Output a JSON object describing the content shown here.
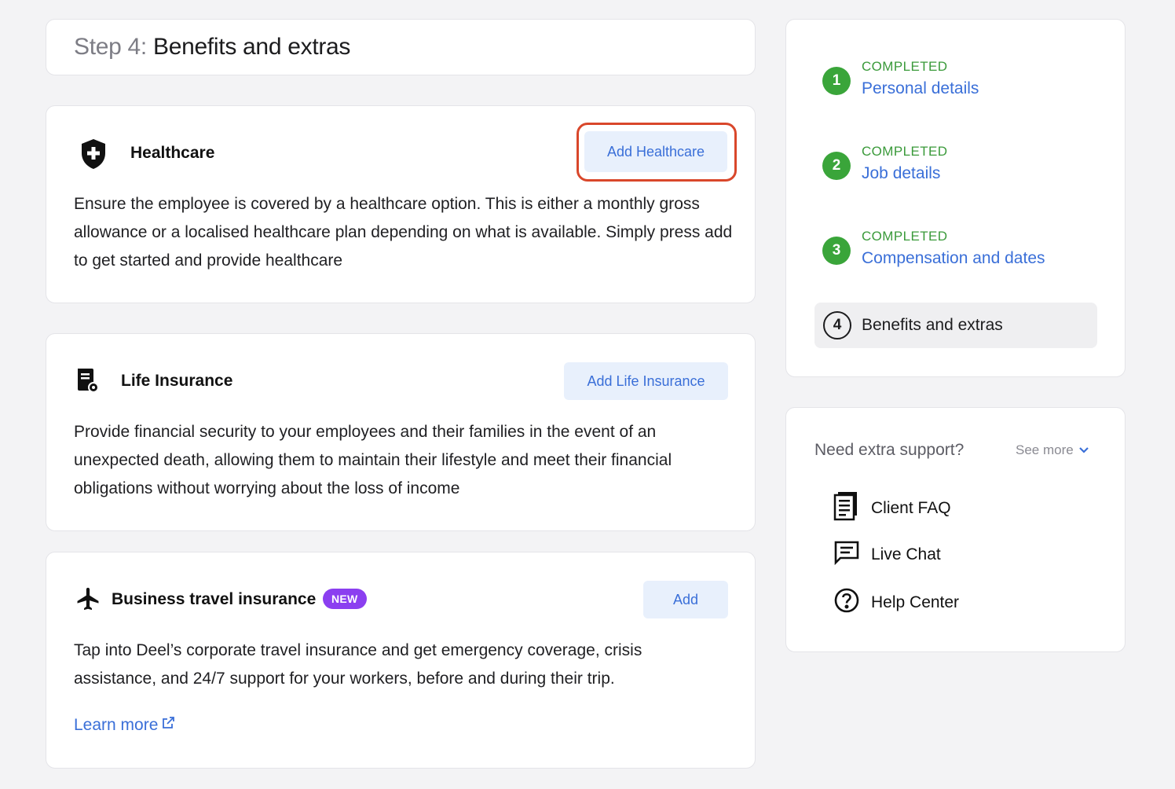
{
  "step_header": {
    "prefix": "Step 4:",
    "title": "Benefits and extras"
  },
  "benefits": {
    "healthcare": {
      "title": "Healthcare",
      "button": "Add Healthcare",
      "icon": "shield-plus-icon",
      "description": "Ensure the employee is covered by a healthcare option. This is either a monthly gross allowance or a localised healthcare plan depending on what is available. Simply press add to get started and provide healthcare"
    },
    "life_insurance": {
      "title": "Life Insurance",
      "button": "Add Life Insurance",
      "icon": "document-gear-icon",
      "description": "Provide financial security to your employees and their families in the event of an unexpected death, allowing them to maintain their lifestyle and meet their financial obligations without worrying about the loss of income"
    },
    "travel": {
      "title": "Business travel insurance",
      "badge": "NEW",
      "button": "Add",
      "icon": "airplane-icon",
      "description": "Tap into Deel’s corporate travel insurance and get emergency coverage, crisis assistance, and 24/7 support for your workers, before and during their trip.",
      "learn_more": "Learn more"
    }
  },
  "stepper": {
    "steps": [
      {
        "number": "1",
        "status": "COMPLETED",
        "label": "Personal details"
      },
      {
        "number": "2",
        "status": "COMPLETED",
        "label": "Job details"
      },
      {
        "number": "3",
        "status": "COMPLETED",
        "label": "Compensation and dates"
      }
    ],
    "current": {
      "number": "4",
      "label": "Benefits and extras"
    }
  },
  "support": {
    "title": "Need extra support?",
    "see_more": "See more",
    "items": [
      {
        "label": "Client FAQ",
        "icon": "document-list-icon"
      },
      {
        "label": "Live Chat",
        "icon": "chat-icon"
      },
      {
        "label": "Help Center",
        "icon": "question-circle-icon"
      }
    ]
  },
  "colors": {
    "accent": "#3a6fd8",
    "completed": "#3aa53a",
    "badge": "#8b3ff0",
    "highlight": "#d9472b"
  }
}
